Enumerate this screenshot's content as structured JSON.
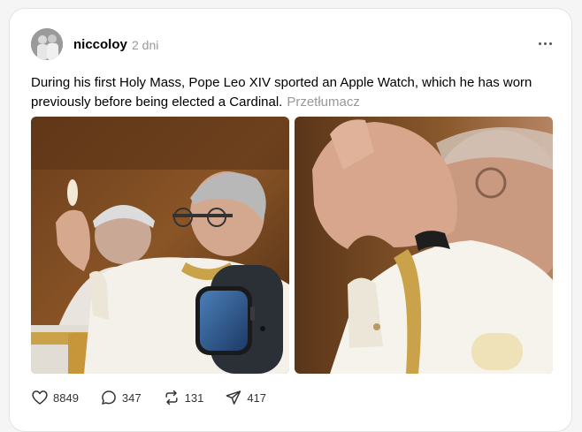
{
  "post": {
    "username": "niccoloy",
    "time": "2 dni",
    "text": "During his first Holy Mass, Pope Leo XIV sported an Apple Watch, which he has worn previously before being elected a Cardinal.",
    "translate_label": "Przetłumacz"
  },
  "actions": {
    "likes": "8849",
    "replies": "347",
    "reposts": "131",
    "shares": "417"
  },
  "icons": {
    "avatar": "avatar-photo",
    "more": "more-horizontal-icon",
    "like": "heart-icon",
    "reply": "comment-bubble-icon",
    "repost": "repost-arrows-icon",
    "share": "send-icon"
  }
}
